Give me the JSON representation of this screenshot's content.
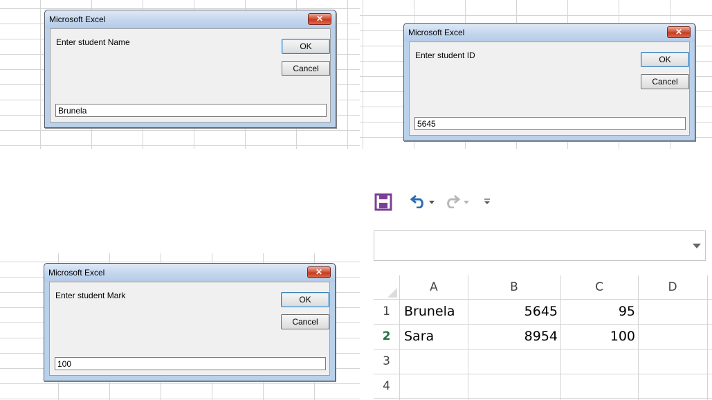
{
  "dialogs": {
    "name": {
      "title": "Microsoft Excel",
      "prompt": "Enter student Name",
      "ok_label": "OK",
      "cancel_label": "Cancel",
      "input_value": "Brunela",
      "close_glyph": "✕"
    },
    "id": {
      "title": "Microsoft Excel",
      "prompt": "Enter student ID",
      "ok_label": "OK",
      "cancel_label": "Cancel",
      "input_value": "5645",
      "close_glyph": "✕"
    },
    "mark": {
      "title": "Microsoft Excel",
      "prompt": "Enter student Mark",
      "ok_label": "OK",
      "cancel_label": "Cancel",
      "input_value": "100",
      "close_glyph": "✕"
    }
  },
  "quick_access": {
    "icons": [
      "save-icon",
      "undo-icon",
      "redo-icon",
      "customize-icon"
    ]
  },
  "sheet": {
    "columns": [
      "A",
      "B",
      "C",
      "D"
    ],
    "rows": [
      {
        "num": "1",
        "cells": [
          "Brunela",
          "5645",
          "95",
          ""
        ]
      },
      {
        "num": "2",
        "cells": [
          "Sara",
          "8954",
          "100",
          ""
        ]
      },
      {
        "num": "3",
        "cells": [
          "",
          "",
          "",
          ""
        ]
      },
      {
        "num": "4",
        "cells": [
          "",
          "",
          "",
          ""
        ]
      }
    ],
    "active_row_color": "#217346"
  }
}
